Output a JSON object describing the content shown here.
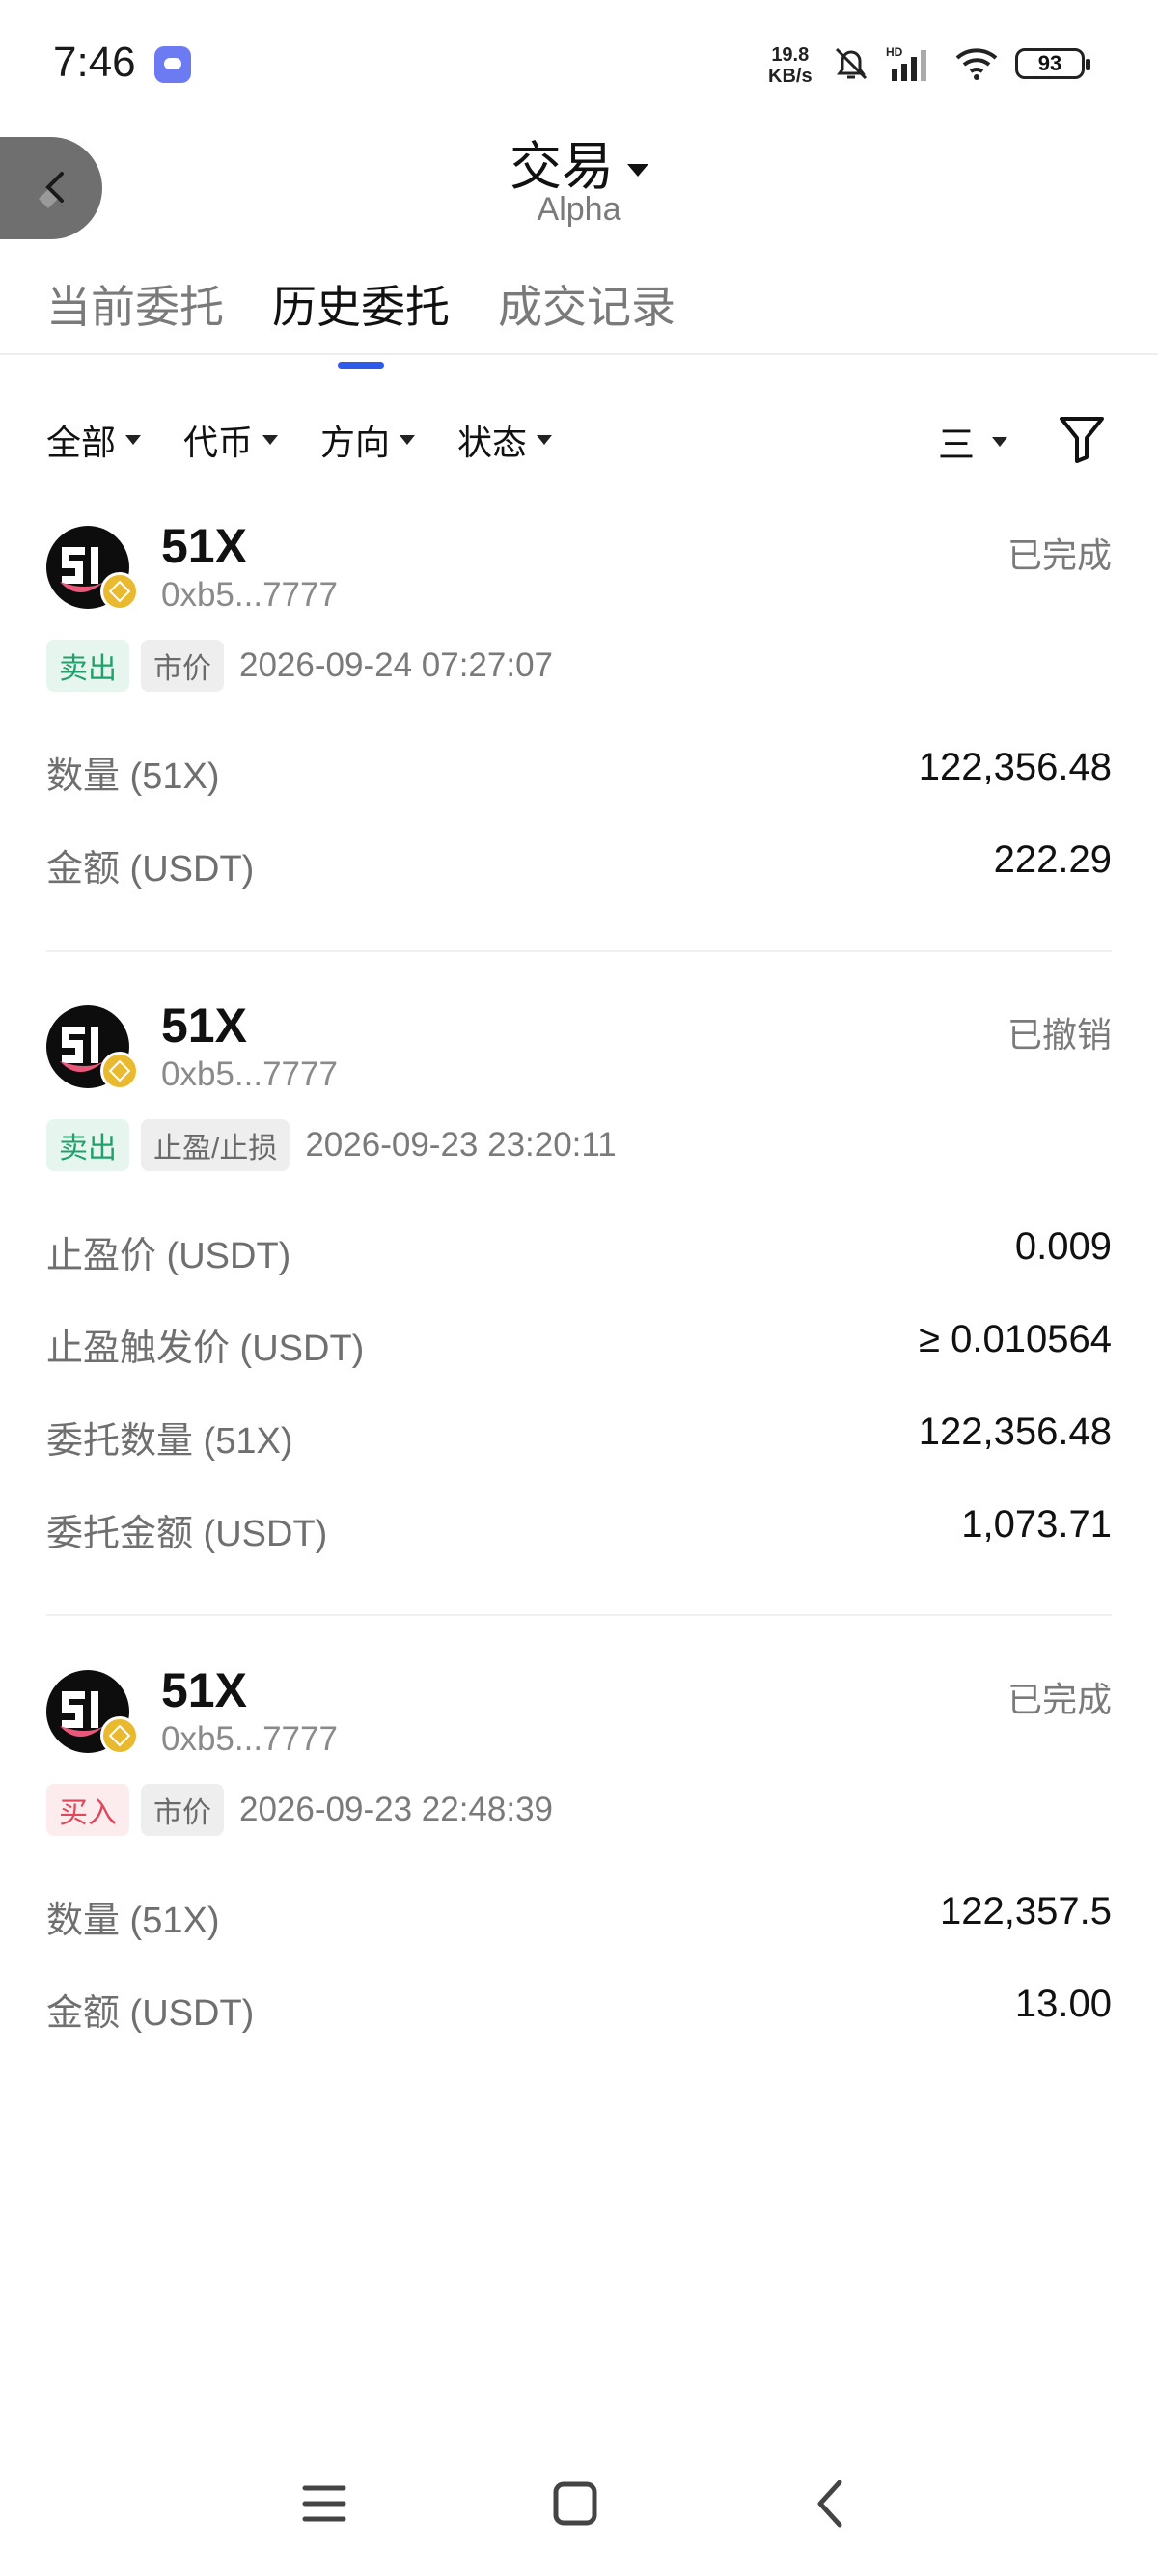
{
  "status_bar": {
    "time": "7:46",
    "speed_value": "19.8",
    "speed_unit": "KB/s",
    "battery": "93"
  },
  "header": {
    "title": "交易",
    "subtitle": "Alpha"
  },
  "tabs": [
    {
      "label": "当前委托",
      "active": false
    },
    {
      "label": "历史委托",
      "active": true
    },
    {
      "label": "成交记录",
      "active": false
    }
  ],
  "filters": [
    {
      "label": "全部"
    },
    {
      "label": "代币"
    },
    {
      "label": "方向"
    },
    {
      "label": "状态"
    }
  ],
  "sort_label": "三",
  "orders": [
    {
      "token": "51X",
      "address": "0xb5...7777",
      "status": "已完成",
      "side": "卖出",
      "type": "市价",
      "time": "2026-09-24 07:27:07",
      "rows": [
        {
          "label": "数量 (51X)",
          "value": "122,356.48"
        },
        {
          "label": "金额 (USDT)",
          "value": "222.29"
        }
      ]
    },
    {
      "token": "51X",
      "address": "0xb5...7777",
      "status": "已撤销",
      "side": "卖出",
      "type": "止盈/止损",
      "time": "2026-09-23 23:20:11",
      "rows": [
        {
          "label": "止盈价 (USDT)",
          "value": "0.009"
        },
        {
          "label": "止盈触发价 (USDT)",
          "value": "≥ 0.010564"
        },
        {
          "label": "委托数量 (51X)",
          "value": "122,356.48"
        },
        {
          "label": "委托金额 (USDT)",
          "value": "1,073.71"
        }
      ]
    },
    {
      "token": "51X",
      "address": "0xb5...7777",
      "status": "已完成",
      "side": "买入",
      "type": "市价",
      "time": "2026-09-23 22:48:39",
      "rows": [
        {
          "label": "数量 (51X)",
          "value": "122,357.5"
        },
        {
          "label": "金额 (USDT)",
          "value": "13.00"
        }
      ]
    }
  ],
  "colors": {
    "accent": "#2f5bea",
    "sell": "#22a06b",
    "buy": "#e0475b"
  }
}
